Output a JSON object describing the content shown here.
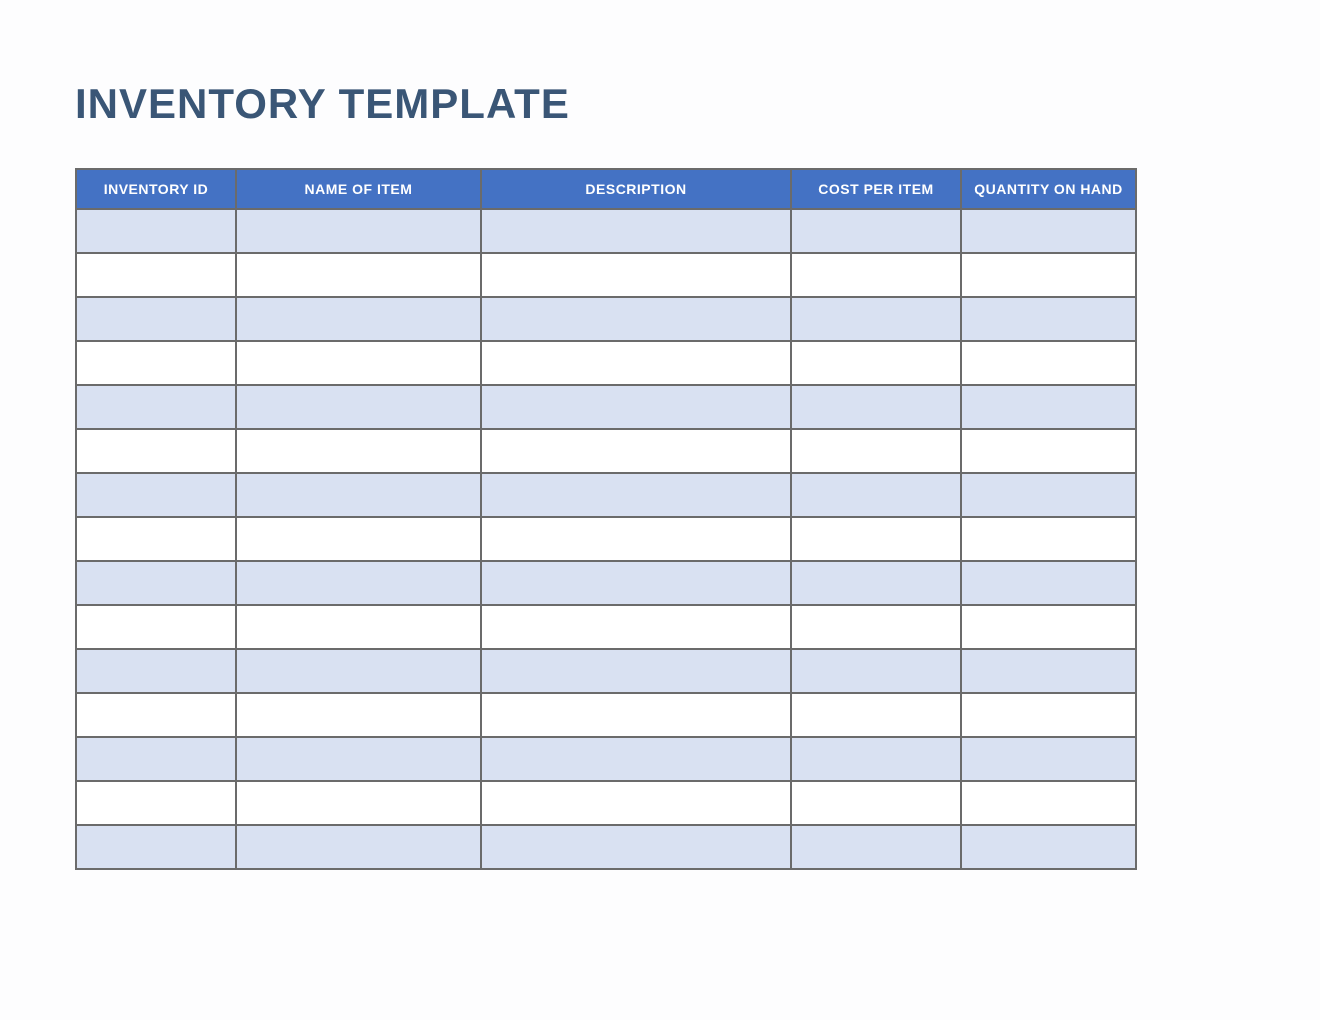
{
  "title": "INVENTORY TEMPLATE",
  "colors": {
    "header_bg": "#4472c4",
    "header_text": "#ffffff",
    "title_text": "#3a5676",
    "row_alt_bg": "#d9e1f2",
    "row_bg": "#ffffff",
    "border": "#6b6b6b"
  },
  "columns": [
    {
      "key": "inventory_id",
      "label": "INVENTORY ID"
    },
    {
      "key": "name_of_item",
      "label": "NAME OF ITEM"
    },
    {
      "key": "description",
      "label": "DESCRIPTION"
    },
    {
      "key": "cost_per_item",
      "label": "COST PER ITEM"
    },
    {
      "key": "quantity_on_hand",
      "label": "QUANTITY ON HAND"
    }
  ],
  "rows": [
    {
      "inventory_id": "",
      "name_of_item": "",
      "description": "",
      "cost_per_item": "",
      "quantity_on_hand": ""
    },
    {
      "inventory_id": "",
      "name_of_item": "",
      "description": "",
      "cost_per_item": "",
      "quantity_on_hand": ""
    },
    {
      "inventory_id": "",
      "name_of_item": "",
      "description": "",
      "cost_per_item": "",
      "quantity_on_hand": ""
    },
    {
      "inventory_id": "",
      "name_of_item": "",
      "description": "",
      "cost_per_item": "",
      "quantity_on_hand": ""
    },
    {
      "inventory_id": "",
      "name_of_item": "",
      "description": "",
      "cost_per_item": "",
      "quantity_on_hand": ""
    },
    {
      "inventory_id": "",
      "name_of_item": "",
      "description": "",
      "cost_per_item": "",
      "quantity_on_hand": ""
    },
    {
      "inventory_id": "",
      "name_of_item": "",
      "description": "",
      "cost_per_item": "",
      "quantity_on_hand": ""
    },
    {
      "inventory_id": "",
      "name_of_item": "",
      "description": "",
      "cost_per_item": "",
      "quantity_on_hand": ""
    },
    {
      "inventory_id": "",
      "name_of_item": "",
      "description": "",
      "cost_per_item": "",
      "quantity_on_hand": ""
    },
    {
      "inventory_id": "",
      "name_of_item": "",
      "description": "",
      "cost_per_item": "",
      "quantity_on_hand": ""
    },
    {
      "inventory_id": "",
      "name_of_item": "",
      "description": "",
      "cost_per_item": "",
      "quantity_on_hand": ""
    },
    {
      "inventory_id": "",
      "name_of_item": "",
      "description": "",
      "cost_per_item": "",
      "quantity_on_hand": ""
    },
    {
      "inventory_id": "",
      "name_of_item": "",
      "description": "",
      "cost_per_item": "",
      "quantity_on_hand": ""
    },
    {
      "inventory_id": "",
      "name_of_item": "",
      "description": "",
      "cost_per_item": "",
      "quantity_on_hand": ""
    },
    {
      "inventory_id": "",
      "name_of_item": "",
      "description": "",
      "cost_per_item": "",
      "quantity_on_hand": ""
    }
  ]
}
